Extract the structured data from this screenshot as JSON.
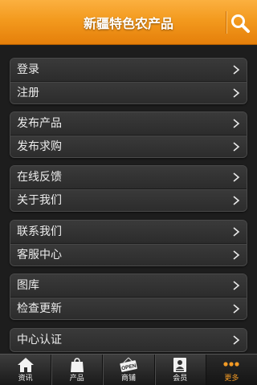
{
  "header": {
    "title": "新疆特色农产品",
    "search_icon": "search-icon",
    "accent": "#f39a1e"
  },
  "menu": {
    "groups": [
      {
        "items": [
          {
            "label": "登录"
          },
          {
            "label": "注册"
          }
        ]
      },
      {
        "items": [
          {
            "label": "发布产品"
          },
          {
            "label": "发布求购"
          }
        ]
      },
      {
        "items": [
          {
            "label": "在线反馈"
          },
          {
            "label": "关于我们"
          }
        ]
      },
      {
        "items": [
          {
            "label": "联系我们"
          },
          {
            "label": "客服中心"
          }
        ]
      },
      {
        "items": [
          {
            "label": "图库"
          },
          {
            "label": "检查更新"
          }
        ]
      },
      {
        "items": [
          {
            "label": "中心认证"
          }
        ]
      }
    ],
    "chevron_icon": "chevron-right-icon"
  },
  "tabbar": {
    "tabs": [
      {
        "label": "资讯",
        "icon": "home-icon"
      },
      {
        "label": "产品",
        "icon": "shopping-bag-icon"
      },
      {
        "label": "商铺",
        "icon": "open-sign-icon",
        "icon_text": "OPEN"
      },
      {
        "label": "会员",
        "icon": "member-card-icon"
      },
      {
        "label": "更多",
        "icon": "more-dots-icon",
        "active": true
      }
    ],
    "active_color": "#f29a25"
  }
}
